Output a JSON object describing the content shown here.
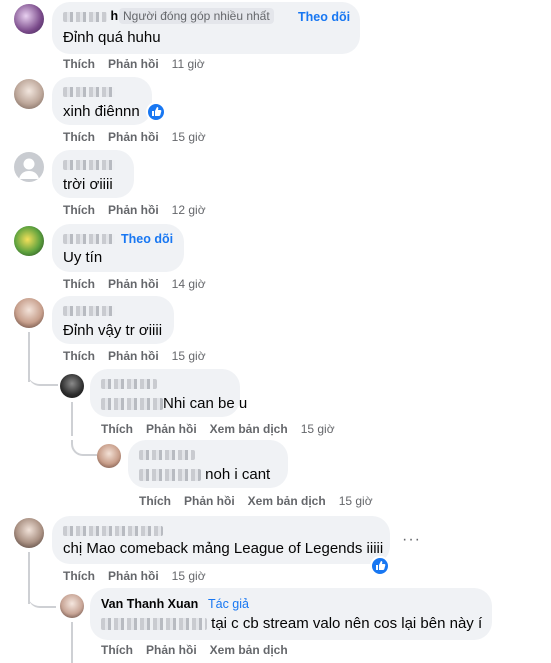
{
  "labels": {
    "like": "Thích",
    "reply": "Phản hồi",
    "see_translation": "Xem bản dịch",
    "follow": "Theo dõi",
    "author": "Tác giả",
    "top_fan": "Người đóng góp nhiều nhất",
    "more": "···"
  },
  "comments": [
    {
      "name_visible": "h",
      "text": "Đỉnh quá huhu",
      "time": "11 giờ"
    },
    {
      "name_visible": "",
      "text": "xinh điênnn",
      "time": "15 giờ"
    },
    {
      "name_visible": "",
      "text": "trời ơiiii",
      "time": "12 giờ"
    },
    {
      "name_visible": "",
      "text": "Uy tín",
      "time": "14 giờ"
    },
    {
      "name_visible": "",
      "text": "Đỉnh vậy tr ơiiii",
      "time": "15 giờ"
    },
    {
      "name_visible": "",
      "text": "Nhi can be u",
      "time": "15 giờ"
    },
    {
      "name_visible": "",
      "text": "noh i cant",
      "time": "15 giờ"
    },
    {
      "name_visible": "",
      "text": "chị Mao comeback mảng League of Legends iiiii",
      "time": "15 giờ"
    },
    {
      "name_visible": "Van Thanh Xuan",
      "text": "tại c cb stream valo nên cos lại bên này í",
      "time": ""
    }
  ],
  "colors": {
    "bubble": "#f0f2f5",
    "link": "#1877f2",
    "meta": "#65676b",
    "thread_line": "#ced0d4"
  }
}
